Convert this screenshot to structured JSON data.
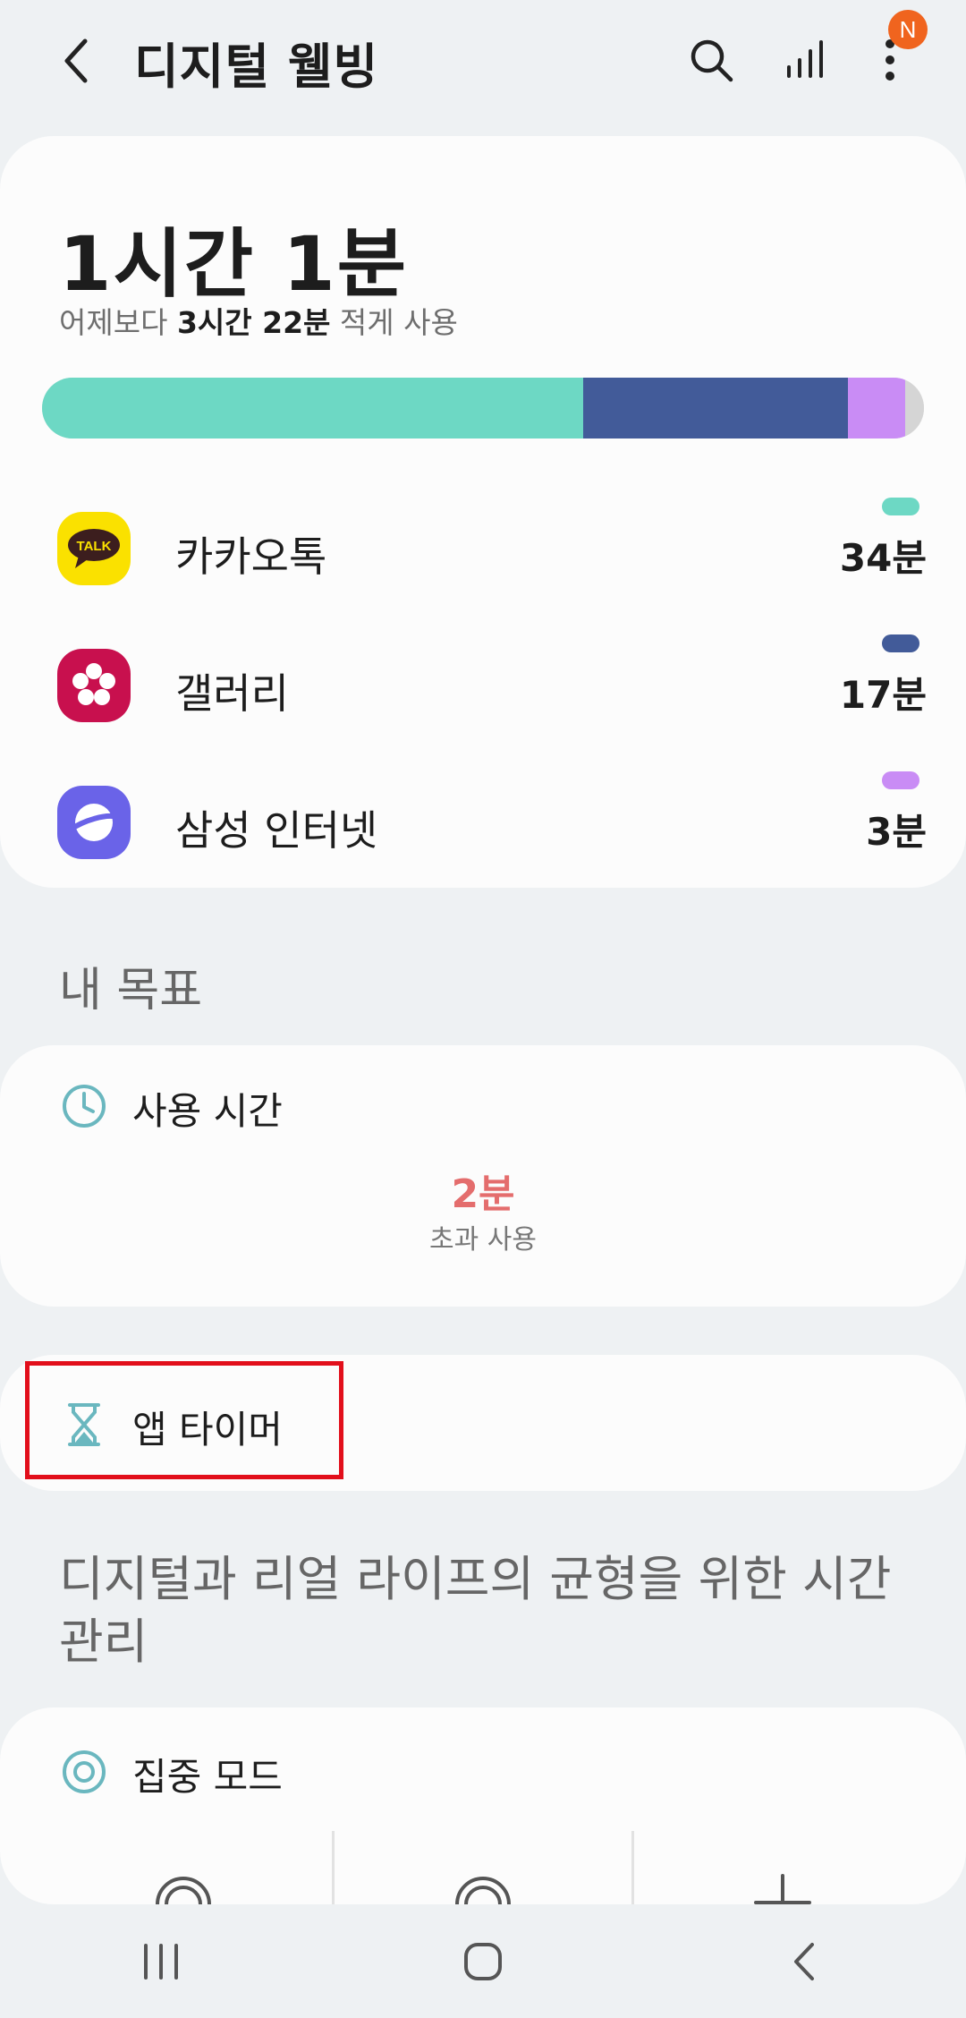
{
  "header": {
    "title": "디지털 웰빙",
    "notification_badge": "N"
  },
  "usage": {
    "total": "1시간 1분",
    "compare_prefix": "어제보다 ",
    "compare_value": "3시간 22분",
    "compare_suffix": " 적게 사용",
    "bar_segments": [
      {
        "label": "카카오톡",
        "fraction": 0.614,
        "color": "#6dd8c4"
      },
      {
        "label": "갤러리",
        "fraction": 0.3,
        "color": "#425b99"
      },
      {
        "label": "삼성 인터넷",
        "fraction": 0.065,
        "color": "#c98cf5"
      },
      {
        "label": "기타",
        "fraction": 0.021,
        "color": "#d5d5d5"
      }
    ],
    "apps": [
      {
        "name": "카카오톡",
        "time": "34분",
        "color": "#6dd8c4",
        "icon": "kakaotalk-icon",
        "icon_text": "TALK"
      },
      {
        "name": "갤러리",
        "time": "17분",
        "color": "#425b99",
        "icon": "gallery-icon"
      },
      {
        "name": "삼성 인터넷",
        "time": "3분",
        "color": "#c98cf5",
        "icon": "samsung-internet-icon"
      }
    ]
  },
  "goals": {
    "section_label": "내 목표",
    "screen_time_title": "사용 시간",
    "screen_time_value": "2분",
    "screen_time_sub": "초과 사용"
  },
  "app_timer": {
    "title": "앱 타이머"
  },
  "description": "디지털과 리얼 라이프의 균형을 위한 시간 관리",
  "focus_mode": {
    "title": "집중 모드"
  }
}
